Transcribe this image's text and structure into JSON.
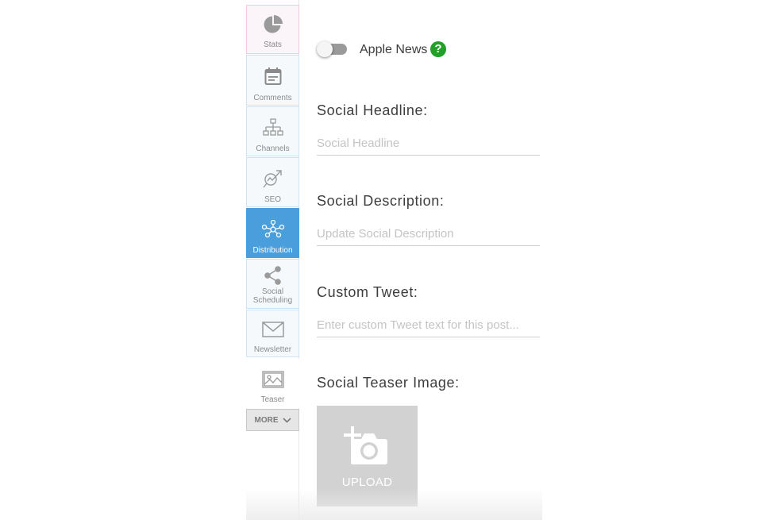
{
  "sidebar": {
    "items": [
      {
        "label": "Stats",
        "icon": "pie-chart-icon"
      },
      {
        "label": "Comments",
        "icon": "calendar-note-icon"
      },
      {
        "label": "Channels",
        "icon": "sitemap-icon"
      },
      {
        "label": "SEO",
        "icon": "magnifier-arrow-icon"
      },
      {
        "label": "Distribution",
        "icon": "network-nodes-icon"
      },
      {
        "label_line1": "Social",
        "label_line2": "Scheduling",
        "icon": "share-icon"
      },
      {
        "label": "Newsletter",
        "icon": "envelope-icon"
      },
      {
        "label": "Teaser",
        "icon": "image-icon"
      }
    ],
    "more_label": "MORE",
    "active_color": "#4a9edb"
  },
  "apple_news": {
    "label": "Apple News",
    "help": "?",
    "enabled": false
  },
  "fields": {
    "social_headline": {
      "label": "Social Headline:",
      "value": "",
      "placeholder": "Social Headline"
    },
    "social_description": {
      "label": "Social Description:",
      "value": "",
      "placeholder": "Update Social Description"
    },
    "custom_tweet": {
      "label": "Custom Tweet:",
      "value": "",
      "placeholder": "Enter custom Tweet text for this post..."
    },
    "social_teaser_image": {
      "label": "Social Teaser Image:",
      "upload_label": "UPLOAD"
    }
  }
}
